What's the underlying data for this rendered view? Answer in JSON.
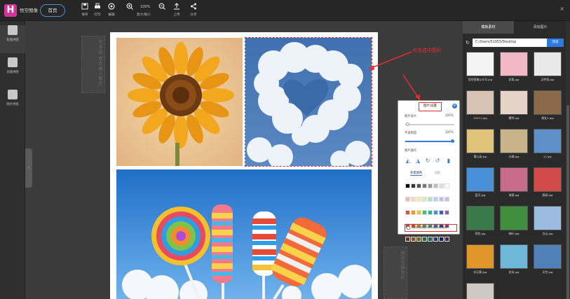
{
  "app": {
    "logo_letter": "H",
    "title": "悟空图像",
    "home_button": "首页",
    "close": "×"
  },
  "toolbar": {
    "save": "保存",
    "print": "打印",
    "edit": "编辑",
    "zoom_percent": "100%",
    "zoom_label": "放大/缩小",
    "upload": "上传",
    "share": "分享"
  },
  "sidebar": {
    "items": [
      {
        "label": "智能拼图",
        "active": true
      },
      {
        "label": "创意拼图",
        "active": false
      },
      {
        "label": "图片拼接",
        "active": false
      }
    ]
  },
  "canvas": {
    "hint_drag_in": "可多选 双击插入图片",
    "hint_swap": "拖动交换图片",
    "photos": [
      {
        "name": "sunflower",
        "colors": [
          "#e89b1e",
          "#c86e12"
        ]
      },
      {
        "name": "heart-cloud",
        "colors": [
          "#4f7fbe",
          "#dce6f2"
        ]
      },
      {
        "name": "lollipops",
        "colors": [
          "#2f86d8",
          "#e8483a"
        ]
      }
    ]
  },
  "annotation": {
    "text": "点击选中图片"
  },
  "settings_popup": {
    "title": "图片设置",
    "zoom_label": "图片放大",
    "zoom_value": "100%",
    "zoom_level": 0.02,
    "opacity_label": "不透明度",
    "opacity_value": "100%",
    "opacity_level": 1.0,
    "ops_label": "图片操作",
    "bg_tab": "背景颜色",
    "frame_tab": "边框",
    "apply_all": "对所有图片执行相同的操作",
    "palette": [
      "#000000",
      "#333333",
      "#555555",
      "#777777",
      "#999999",
      "#bbbbbb",
      "#dddddd",
      "#ffffff",
      "#f5b7b1",
      "#f9d7a6",
      "#fbeaa1",
      "#d5f0a8",
      "#a8e6cf",
      "#a8d8f0",
      "#b4c4f0",
      "#d6b4f0",
      "#e74c3c",
      "#f39c12",
      "#f1c40f",
      "#2ecc71",
      "#1abc9c",
      "#3498db",
      "#2c5ee8",
      "#9b59b6",
      "#c0392b",
      "#d35400",
      "#b7950b",
      "#27ae60",
      "#16a085",
      "#2174c0",
      "#1a3fa8",
      "#7d3c98",
      "#7b241c",
      "#935116",
      "#7d6608",
      "#196f3d",
      "#0e6655",
      "#154360",
      "#0b1f6b",
      "#4a235a"
    ]
  },
  "right_panel": {
    "tab_templates": "模板素材",
    "tab_add": "添加图片",
    "path": "C:/Users/51955/Desktop",
    "browse": "浏览",
    "thumbnails": [
      {
        "label": "悟空图像公众号.jpg",
        "color": "#f4f4f4"
      },
      {
        "label": "花絮.jpg",
        "color": "#f2b8c6"
      },
      {
        "label": "证件照.jpg",
        "color": "#e9e9e9"
      },
      {
        "label": "20111.jpg",
        "color": "#d9c3b5"
      },
      {
        "label": "模特.jpg",
        "color": "#e6d3c8"
      },
      {
        "label": "美女1.jpg",
        "color": "#8a6a4a"
      },
      {
        "label": "蒲公英.jpg",
        "color": "#e0c37a"
      },
      {
        "label": "沙滩.jpg",
        "color": "#c9b38a"
      },
      {
        "label": "心.jpg",
        "color": "#5f8fc9"
      },
      {
        "label": "蓝天.jpg",
        "color": "#4a90d9"
      },
      {
        "label": "海报.jpg",
        "color": "#c86a8a"
      },
      {
        "label": "春游.jpg",
        "color": "#d24a4a"
      },
      {
        "label": "荷花.jpg",
        "color": "#3a7a4a"
      },
      {
        "label": "绿叶.jpg",
        "color": "#3f8f3f"
      },
      {
        "label": "白云.jpg",
        "color": "#9bbbe0"
      },
      {
        "label": "向日葵.jpg",
        "color": "#e0952a"
      },
      {
        "label": "花朵.jpg",
        "color": "#6fb7d9"
      },
      {
        "label": "天空.jpg",
        "color": "#4f82b8"
      },
      {
        "label": "人物.jpg",
        "color": "#cfc9c4"
      }
    ]
  }
}
